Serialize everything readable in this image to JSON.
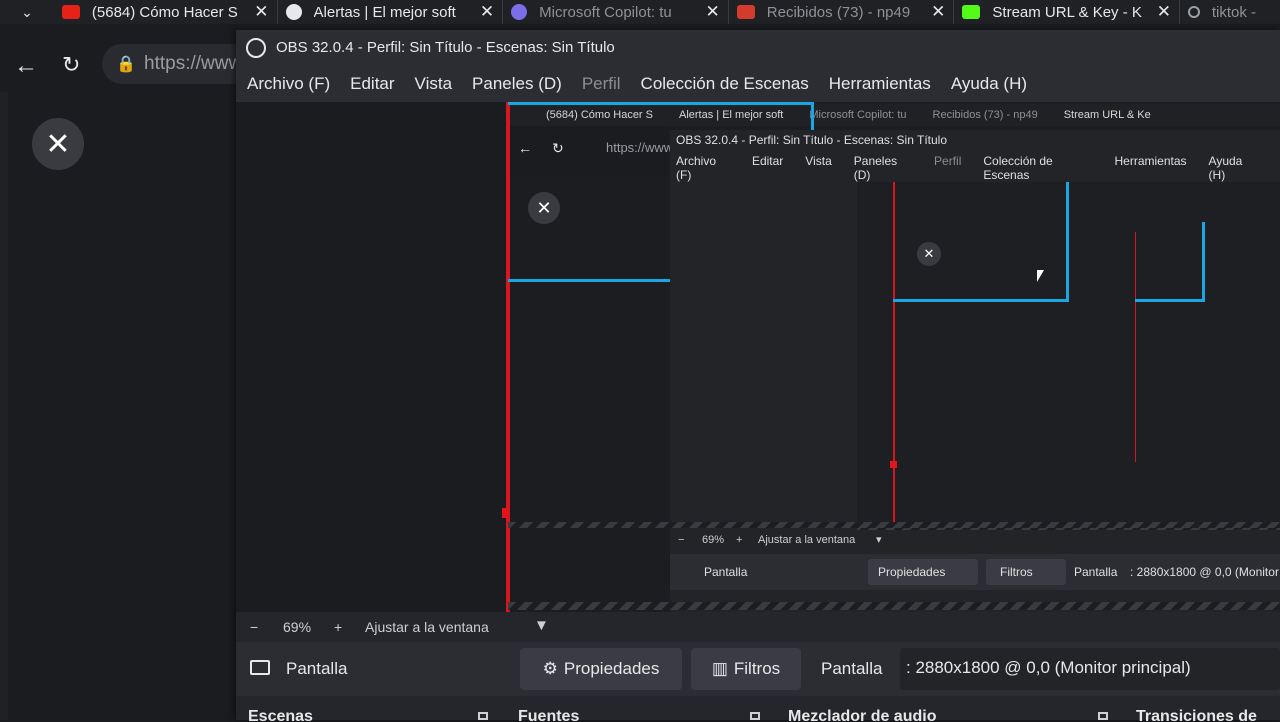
{
  "browser": {
    "tabs": [
      {
        "title": "(5684) Cómo Hacer S",
        "favicon_color": "#e62117"
      },
      {
        "title": "Alertas | El mejor soft",
        "favicon_color": "#e8e8ea"
      },
      {
        "title": "Microsoft Copilot: tu",
        "favicon_color": "#7b6ee8"
      },
      {
        "title": "Recibidos (73) - np49",
        "favicon_color": "#d33b2c"
      },
      {
        "title": "Stream URL & Key - K",
        "favicon_color": "#53fc18"
      },
      {
        "title": "tiktok -",
        "favicon_color": "#9aa0a6"
      }
    ],
    "url": "https://www"
  },
  "obs": {
    "title": "OBS 32.0.4 - Perfil: Sin Título - Escenas: Sin Título",
    "menu": [
      {
        "label": "Archivo (F)",
        "disabled": false
      },
      {
        "label": "Editar",
        "disabled": false
      },
      {
        "label": "Vista",
        "disabled": false
      },
      {
        "label": "Paneles (D)",
        "disabled": false
      },
      {
        "label": "Perfil",
        "disabled": true
      },
      {
        "label": "Colección de Escenas",
        "disabled": false
      },
      {
        "label": "Herramientas",
        "disabled": false
      },
      {
        "label": "Ayuda (H)",
        "disabled": false
      }
    ],
    "zoom": {
      "minus": "−",
      "value": "69%",
      "plus": "+",
      "fit": "Ajustar a la ventana"
    },
    "source": {
      "name": "Pantalla",
      "properties": "Propiedades",
      "filters": "Filtros",
      "label": "Pantalla",
      "info": ": 2880x1800 @ 0,0 (Monitor principal)"
    },
    "docks": [
      "Escenas",
      "Fuentes",
      "Mezclador de audio",
      "Transiciones de"
    ]
  },
  "nested": {
    "tabs": [
      "(5684) Cómo Hacer S",
      "Alertas | El mejor soft",
      "Microsoft Copilot: tu",
      "Recibidos (73) - np49",
      "Stream URL & Ke"
    ],
    "url": "https://www",
    "obs_title": "OBS 32.0.4 - Perfil: Sin Título - Escenas: Sin Título",
    "menu": [
      "Archivo (F)",
      "Editar",
      "Vista",
      "Paneles (D)",
      "Perfil",
      "Colección de Escenas",
      "Herramientas",
      "Ayuda (H)"
    ],
    "zoom": "69%",
    "fit": "Ajustar a la ventana",
    "source_name": "Pantalla",
    "properties": "Propiedades",
    "filters": "Filtros",
    "source_label": "Pantalla",
    "source_info": ": 2880x1800 @ 0,0 (Monitor"
  },
  "colors": {
    "accent_red": "#d7171f",
    "selection_cyan": "#18a6e4"
  }
}
